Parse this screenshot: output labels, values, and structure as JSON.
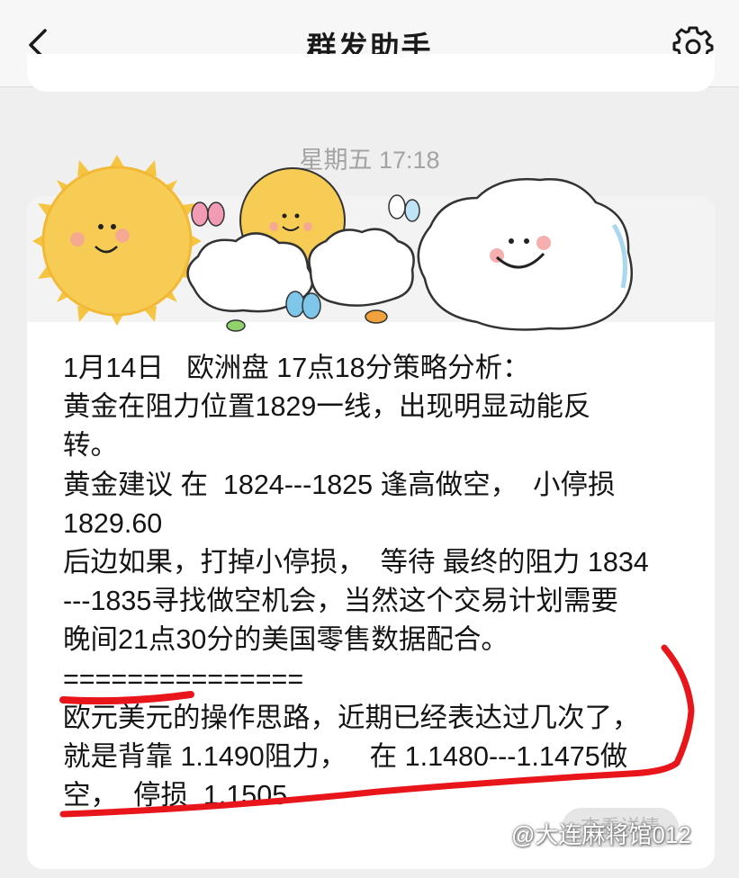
{
  "nav": {
    "title": "群发助手",
    "back_icon": "chevron-left-icon",
    "settings_icon": "gear-icon"
  },
  "timestamp": "星期五 17:18",
  "message": {
    "lines": [
      "1月14日   欧洲盘 17点18分策略分析：",
      "黄金在阻力位置1829一线，出现明显动能反",
      "转。",
      "黄金建议 在  1824---1825 逢高做空，  小停损",
      "1829.60",
      "后边如果，打掉小停损，  等待 最终的阻力 1834",
      "---1835寻找做空机会，当然这个交易计划需要",
      "晚间21点30分的美国零售数据配合。",
      "===============",
      "欧元美元的操作思路，近期已经表达过几次了，",
      "就是背靠 1.1490阻力，   在 1.1480---1.1475做",
      "空，  停损  1.1505"
    ]
  },
  "read_more": "查看详情",
  "watermark": "@大连麻将馆012",
  "colors": {
    "annotation": "#e8161b",
    "sun": "#f7c948",
    "background": "#efefef"
  }
}
